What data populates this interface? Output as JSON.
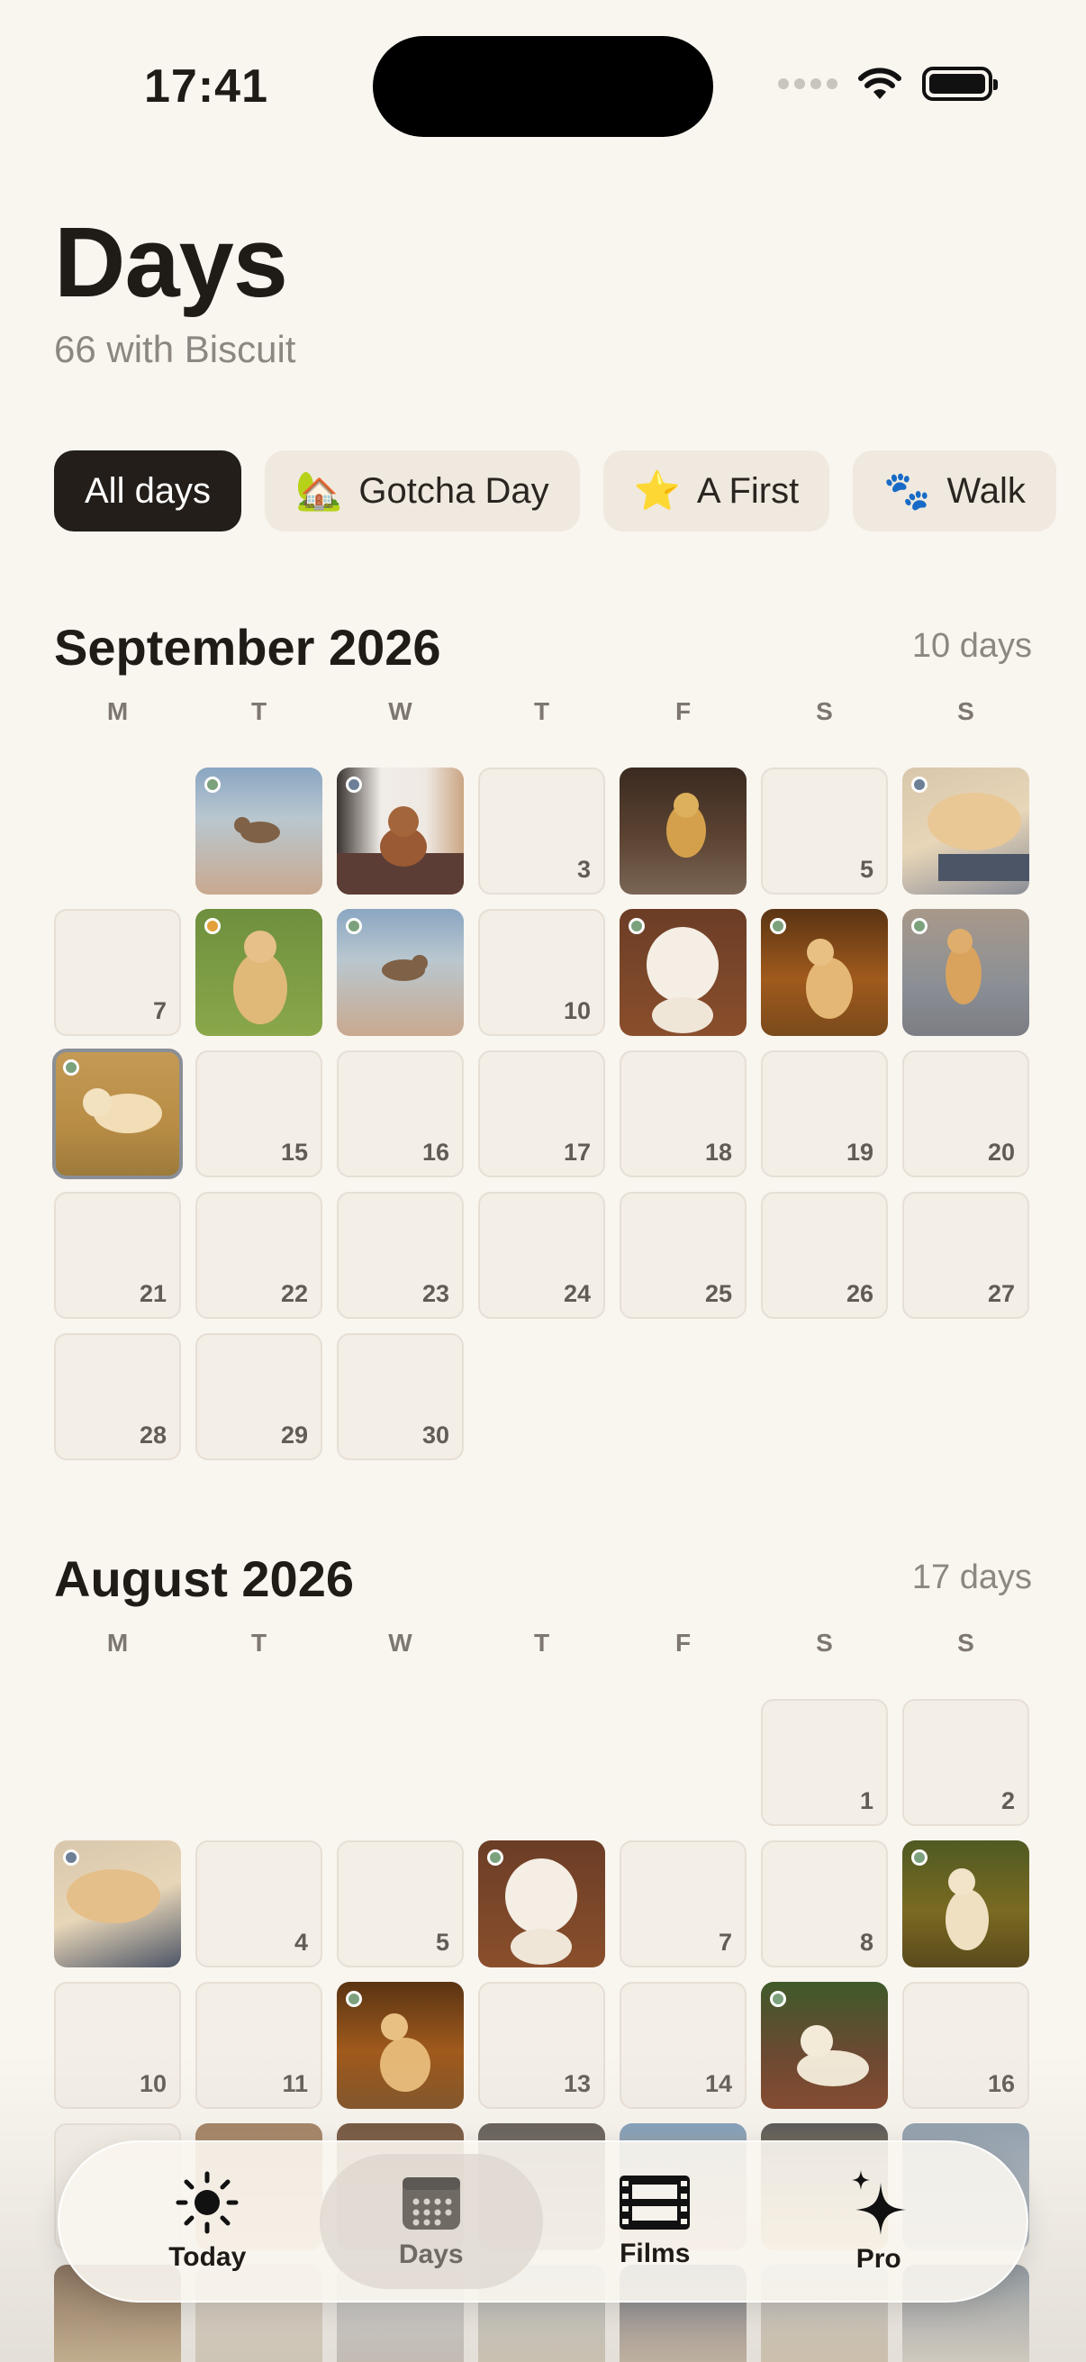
{
  "status": {
    "time": "17:41"
  },
  "header": {
    "title": "Days",
    "subtitle": "66 with Biscuit"
  },
  "filters": [
    {
      "label": "All days",
      "icon": "",
      "active": true
    },
    {
      "label": "Gotcha Day",
      "icon": "🏡",
      "active": false
    },
    {
      "label": "A First",
      "icon": "⭐",
      "active": false
    },
    {
      "label": "Walk",
      "icon": "🐾",
      "active": false
    }
  ],
  "weekdays": [
    "M",
    "T",
    "W",
    "T",
    "F",
    "S",
    "S"
  ],
  "months": [
    {
      "title": "September 2026",
      "count": "10 days"
    },
    {
      "title": "August 2026",
      "count": "17 days"
    }
  ],
  "tabs": [
    {
      "label": "Today",
      "icon": "sun-icon"
    },
    {
      "label": "Days",
      "icon": "calendar-icon"
    },
    {
      "label": "Films",
      "icon": "film-icon"
    },
    {
      "label": "Pro",
      "icon": "sparkles-icon"
    }
  ],
  "colors": {
    "background": "#f9f5ef",
    "active_chip": "#231e1a",
    "dot_green": "#7ca17d",
    "dot_orange": "#e3a03b"
  }
}
